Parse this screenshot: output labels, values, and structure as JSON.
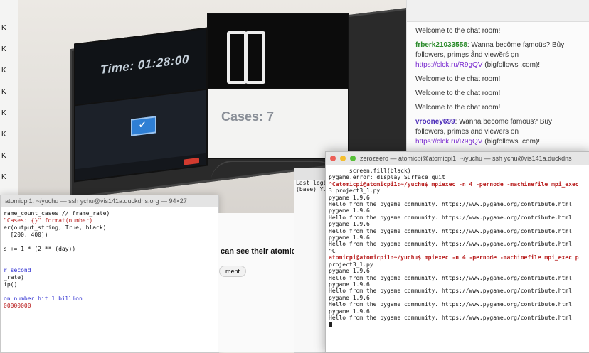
{
  "left_strip": {
    "items": [
      "K",
      "K",
      "K",
      "K",
      "K",
      "K",
      "K",
      "K",
      "K"
    ]
  },
  "photo": {
    "time_text": "Time: 01:28:00",
    "cases_text": "Cases: 7",
    "zoom_tile_icon": "check-icon"
  },
  "chat": {
    "messages": [
      {
        "user": "",
        "text": "Welcome to the chat room!"
      },
      {
        "user": "frberk21033558",
        "text": ": Wanna becôme fąmoüs? Bûy followers, primęs ånd viewĕrś ọn ",
        "link": "https://clck.ru/R9gQV",
        "after": " (bigfollows .com)!"
      },
      {
        "user": "",
        "text": "Welcome to the chat room!"
      },
      {
        "user": "",
        "text": "Welcome to the chat room!"
      },
      {
        "user": "",
        "text": "Welcome to the chat room!"
      },
      {
        "user": "vrooney699",
        "text": ": Wanna become famous? Buy followers, primes and viewers on ",
        "link": "https://clck.ru/R9gQV",
        "after": " (bigfollows .com)!"
      }
    ]
  },
  "term1": {
    "title": "atomicpi1: ~/yuchu — ssh ychu@vis141a.duckdns.org — 94×27",
    "lines": [
      "rame_count_cases // frame_rate)",
      "\"Cases: {}\".format(number)",
      "",
      "er(output_string, True, black)",
      "  [200, 400])",
      "",
      "s += 1 * (2 ** (day))",
      "",
      "",
      "r second",
      "_rate)",
      "ip()",
      "",
      "on number hit 1 billion",
      "00000000"
    ]
  },
  "mid": {
    "text": "can see their atomic p",
    "chip": "ment"
  },
  "term_back": {
    "lines": [
      "Last logi",
      "(base) Yu"
    ]
  },
  "term2": {
    "title": "zerozeero — atomicpi@atomicpi1: ~/yuchu — ssh ychu@vis141a.duckdns",
    "lines": [
      "      screen.fill(black)",
      "pygame.error: display Surface quit",
      "^Catomicpi@atomicpi1:~/yuchu$ mpiexec -n 4 -pernode -machinefile mpi_exec",
      "3 project3_1.py",
      "pygame 1.9.6",
      "Hello from the pygame community. https://www.pygame.org/contribute.html",
      "pygame 1.9.6",
      "Hello from the pygame community. https://www.pygame.org/contribute.html",
      "pygame 1.9.6",
      "Hello from the pygame community. https://www.pygame.org/contribute.html",
      "pygame 1.9.6",
      "Hello from the pygame community. https://www.pygame.org/contribute.html",
      "^C",
      "atomicpi@atomicpi1:~/yuchu$ mpiexec -n 4 -pernode -machinefile mpi_exec p",
      "project3_1.py",
      "pygame 1.9.6",
      "Hello from the pygame community. https://www.pygame.org/contribute.html",
      "pygame 1.9.6",
      "Hello from the pygame community. https://www.pygame.org/contribute.html",
      "pygame 1.9.6",
      "Hello from the pygame community. https://www.pygame.org/contribute.html",
      "pygame 1.9.6",
      "Hello from the pygame community. https://www.pygame.org/contribute.html"
    ]
  }
}
